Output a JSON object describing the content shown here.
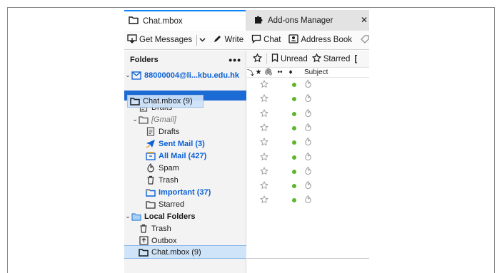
{
  "tabs": [
    {
      "label": "Chat.mbox",
      "icon": "folder-icon",
      "active": true
    },
    {
      "label": "Add-ons Manager",
      "icon": "puzzle-icon",
      "active": false
    }
  ],
  "toolbar": {
    "get_messages": "Get Messages",
    "write": "Write",
    "chat": "Chat",
    "address_book": "Address Book"
  },
  "folder_pane": {
    "header": "Folders",
    "menu": "•••",
    "account": "88000004@li...kbu.edu.hk",
    "drag_ghost": "Chat.mbox (9)",
    "items": [
      {
        "label": "Drafts",
        "icon": "drafts-icon"
      },
      {
        "label": "[Gmail]",
        "icon": "folder-icon"
      },
      {
        "label": "Drafts",
        "icon": "drafts-icon"
      },
      {
        "label": "Sent Mail (3)",
        "icon": "sent-icon"
      },
      {
        "label": "All Mail (427)",
        "icon": "archive-icon"
      },
      {
        "label": "Spam",
        "icon": "spam-icon"
      },
      {
        "label": "Trash",
        "icon": "trash-icon"
      },
      {
        "label": "Important (37)",
        "icon": "folder-icon"
      },
      {
        "label": "Starred",
        "icon": "folder-icon"
      },
      {
        "label": "Local Folders",
        "icon": "folder-icon"
      },
      {
        "label": "Trash",
        "icon": "trash-icon"
      },
      {
        "label": "Outbox",
        "icon": "outbox-icon"
      },
      {
        "label": "Chat.mbox (9)",
        "icon": "folder-icon"
      }
    ]
  },
  "quick_filter": {
    "unread": "Unread",
    "starred": "Starred"
  },
  "columns": {
    "subject": "Subject"
  },
  "message_count": 9,
  "colors": {
    "accent": "#0a84ff",
    "selected": "#1c6ad4",
    "folder_blue": "#0a60d6",
    "unread_dot": "#5fb52a"
  }
}
